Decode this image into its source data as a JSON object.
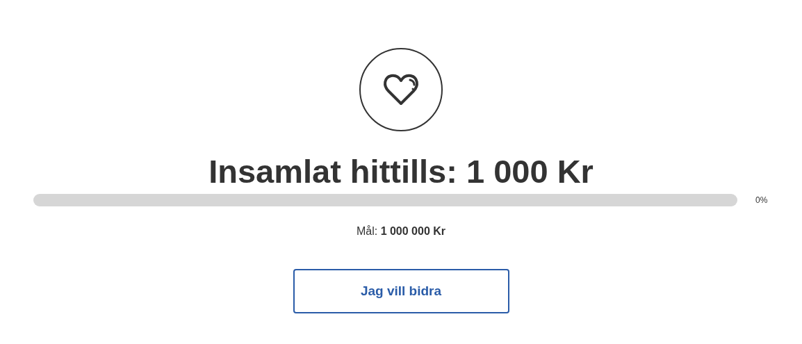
{
  "heading": "Insamlat hittills: 1 000 Kr",
  "progress": {
    "level": 0,
    "reading": "0%"
  },
  "goal": "Mål: **1 000 000 Kr**",
  "button": "Jag vill bidra"
}
